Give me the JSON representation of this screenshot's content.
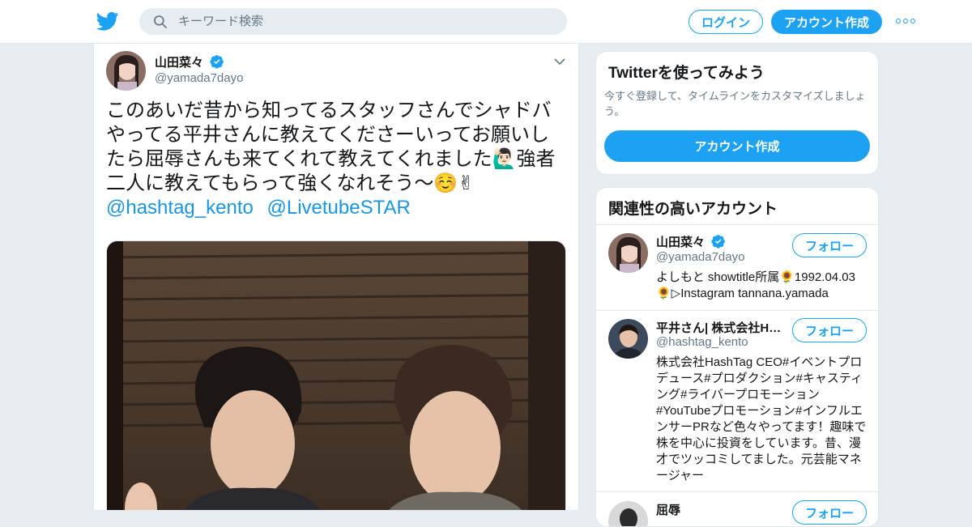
{
  "header": {
    "search_placeholder": "キーワード検索",
    "login_label": "ログイン",
    "signup_label": "アカウント作成",
    "brand_color": "#1da1f2",
    "icons": [
      "twitter-logo-icon",
      "search-icon",
      "more-icon"
    ]
  },
  "tweet": {
    "author_name": "山田菜々",
    "author_handle": "@yamada7dayo",
    "verified": true,
    "text": "このあいだ昔から知ってるスタッフさんでシャドバやってる平井さんに教えてくださーいってお願いしたら屈辱さんも来てくれて教えてくれました🙋🏻‍♂️強者二人に教えてもらって強くなれそう〜☺️✌",
    "mentions": [
      "@hashtag_kento",
      "@LivetubeSTAR"
    ],
    "link_color": "#1b95e0"
  },
  "sidebar": {
    "signup_card": {
      "title": "Twitterを使ってみよう",
      "subtitle": "今すぐ登録して、タイムラインをカスタマイズしましょう。",
      "button_label": "アカウント作成"
    },
    "related": {
      "title": "関連性の高いアカウント",
      "follow_label": "フォロー",
      "accounts": [
        {
          "name": "山田菜々",
          "handle": "@yamada7dayo",
          "verified": true,
          "bio": "よしもと showtitle所属🌻1992.04.03🌻▷Instagram tannana.yamada"
        },
        {
          "name": "平井さん| 株式会社H…",
          "handle": "@hashtag_kento",
          "verified": false,
          "bio": "株式会社HashTag CEO#イベントプロデュース#プロダクション#キャスティング#ライバープロモーション#YouTubeプロモーション#インフルエンサーPRなど色々やってます！趣味で株を中心に投資をしています。昔、漫才でツッコミしてました。元芸能マネージャー"
        },
        {
          "name": "屈辱",
          "handle": "",
          "verified": false,
          "bio": ""
        }
      ]
    }
  }
}
